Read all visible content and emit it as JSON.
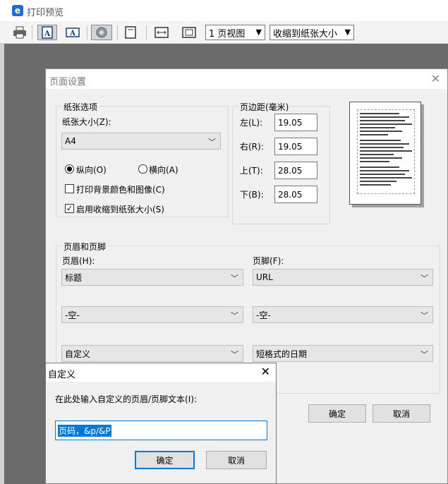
{
  "window": {
    "title": "打印预览",
    "app_icon_letter": "e"
  },
  "toolbar": {
    "view_select": "1 页视图",
    "shrink_select": "收缩到纸张大小"
  },
  "page_setup": {
    "title": "页面设置",
    "close": "✕",
    "paper_options": {
      "group_label": "纸张选项",
      "size_label": "纸张大小(Z):",
      "size_value": "A4",
      "portrait": "纵向(O)",
      "landscape": "横向(A)",
      "print_bg": "打印背景颜色和图像(C)",
      "shrink_to_fit": "启用收缩到纸张大小(S)"
    },
    "margins": {
      "group_label": "页边距(毫米)",
      "left_label": "左(L):",
      "left_value": "19.05",
      "right_label": "右(R):",
      "right_value": "19.05",
      "top_label": "上(T):",
      "top_value": "28.05",
      "bottom_label": "下(B):",
      "bottom_value": "28.05"
    },
    "header_footer": {
      "group_label": "页眉和页脚",
      "header_label": "页眉(H):",
      "footer_label": "页脚(F):",
      "header_1": "标题",
      "footer_1": "URL",
      "header_2": "-空-",
      "footer_2": "-空-",
      "header_3": "自定义",
      "footer_3": "短格式的日期"
    },
    "ok": "确定",
    "cancel": "取消"
  },
  "custom_dialog": {
    "title": "自定义",
    "close": "✕",
    "prompt": "在此处输入自定义的页眉/页脚文本(I):",
    "input_value": "页码，&p/&P",
    "ok": "确定",
    "cancel": "取消"
  },
  "colors": {
    "accent": "#0078d7",
    "preview_bg": "#6b6b6b",
    "dialog_bg": "#f0f0f0"
  },
  "icons": [
    "ie-icon",
    "print-icon",
    "portrait-icon",
    "landscape-icon",
    "settings-icon",
    "fullpage-icon",
    "pagewidth-icon",
    "shrink-icon",
    "chevron-down-icon",
    "close-icon"
  ]
}
